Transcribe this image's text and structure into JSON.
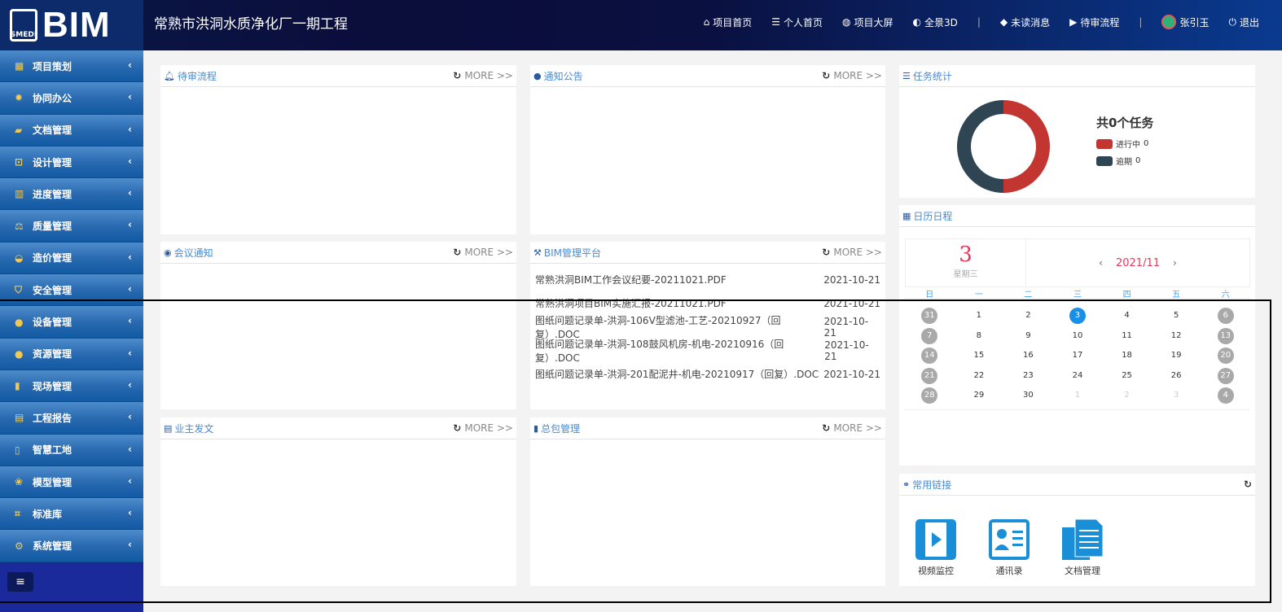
{
  "header": {
    "logo_text": "BIM",
    "logo_sub": "SMEDI",
    "title": "常熟市洪洞水质净化厂一期工程",
    "nav": [
      {
        "icon": "home-icon",
        "glyph": "⌂",
        "label": "项目首页"
      },
      {
        "icon": "stack-icon",
        "glyph": "☰",
        "label": "个人首页"
      },
      {
        "icon": "globe-icon",
        "glyph": "◍",
        "label": "项目大屏"
      },
      {
        "icon": "pie-icon",
        "glyph": "◐",
        "label": "全景3D"
      },
      {
        "icon": "layers-icon",
        "glyph": "◆",
        "label": "未读消息"
      },
      {
        "icon": "flag-icon",
        "glyph": "▶",
        "label": "待审流程"
      }
    ],
    "user": "张引玉",
    "logout": "退出"
  },
  "sidebar": {
    "items": [
      {
        "label": "项目策划",
        "glyph": "▦"
      },
      {
        "label": "协同办公",
        "glyph": "✹"
      },
      {
        "label": "文档管理",
        "glyph": "▰"
      },
      {
        "label": "设计管理",
        "glyph": "⊡"
      },
      {
        "label": "进度管理",
        "glyph": "▥"
      },
      {
        "label": "质量管理",
        "glyph": "⚖"
      },
      {
        "label": "造价管理",
        "glyph": "◒"
      },
      {
        "label": "安全管理",
        "glyph": "⛉"
      },
      {
        "label": "设备管理",
        "glyph": "●"
      },
      {
        "label": "资源管理",
        "glyph": "●"
      },
      {
        "label": "现场管理",
        "glyph": "▮"
      },
      {
        "label": "工程报告",
        "glyph": "▤"
      },
      {
        "label": "智慧工地",
        "glyph": "▯"
      },
      {
        "label": "模型管理",
        "glyph": "❀"
      },
      {
        "label": "标准库",
        "glyph": "⌗"
      },
      {
        "label": "系统管理",
        "glyph": "⚙"
      }
    ],
    "toggle": "≡"
  },
  "panels": {
    "more": "MORE >>",
    "pending": "待审流程",
    "notice": "通知公告",
    "meeting": "会议通知",
    "bim": "BIM管理平台",
    "owner": "业主发文",
    "contractor": "总包管理",
    "bim_files": [
      {
        "name": "常熟洪洞BIM工作会议纪要-20211021.PDF",
        "date": "2021-10-21"
      },
      {
        "name": "常熟洪洞项目BIM实施汇报-20211021.PDF",
        "date": "2021-10-21"
      },
      {
        "name": "图纸问题记录单-洪洞-106V型滤池-工艺-20210927（回复）.DOC",
        "date": "2021-10-21"
      },
      {
        "name": "图纸问题记录单-洪洞-108鼓风机房-机电-20210916（回复）.DOC",
        "date": "2021-10-21"
      },
      {
        "name": "图纸问题记录单-洪洞-201配泥井-机电-20210917（回复）.DOC",
        "date": "2021-10-21"
      }
    ]
  },
  "tasks": {
    "title": "任务统计",
    "total": "共0个任务",
    "legend": [
      {
        "label": "进行中",
        "value": "0",
        "color": "#c23531"
      },
      {
        "label": "逾期",
        "value": "0",
        "color": "#2f4554"
      }
    ]
  },
  "calendar": {
    "title": "日历日程",
    "day": "3",
    "weekday": "星期三",
    "month": "2021/11",
    "weekdays": [
      "日",
      "一",
      "二",
      "三",
      "四",
      "五",
      "六"
    ],
    "days": [
      "31",
      "1",
      "2",
      "3",
      "4",
      "5",
      "6",
      "7",
      "8",
      "9",
      "10",
      "11",
      "12",
      "13",
      "14",
      "15",
      "16",
      "17",
      "18",
      "19",
      "20",
      "21",
      "22",
      "23",
      "24",
      "25",
      "26",
      "27",
      "28",
      "29",
      "30",
      "1",
      "2",
      "3",
      "4"
    ],
    "today_index": 3,
    "other_month": [
      0,
      31,
      32,
      33,
      34
    ]
  },
  "links": {
    "title": "常用链接",
    "items": [
      "视频监控",
      "通讯录",
      "文档管理"
    ]
  }
}
